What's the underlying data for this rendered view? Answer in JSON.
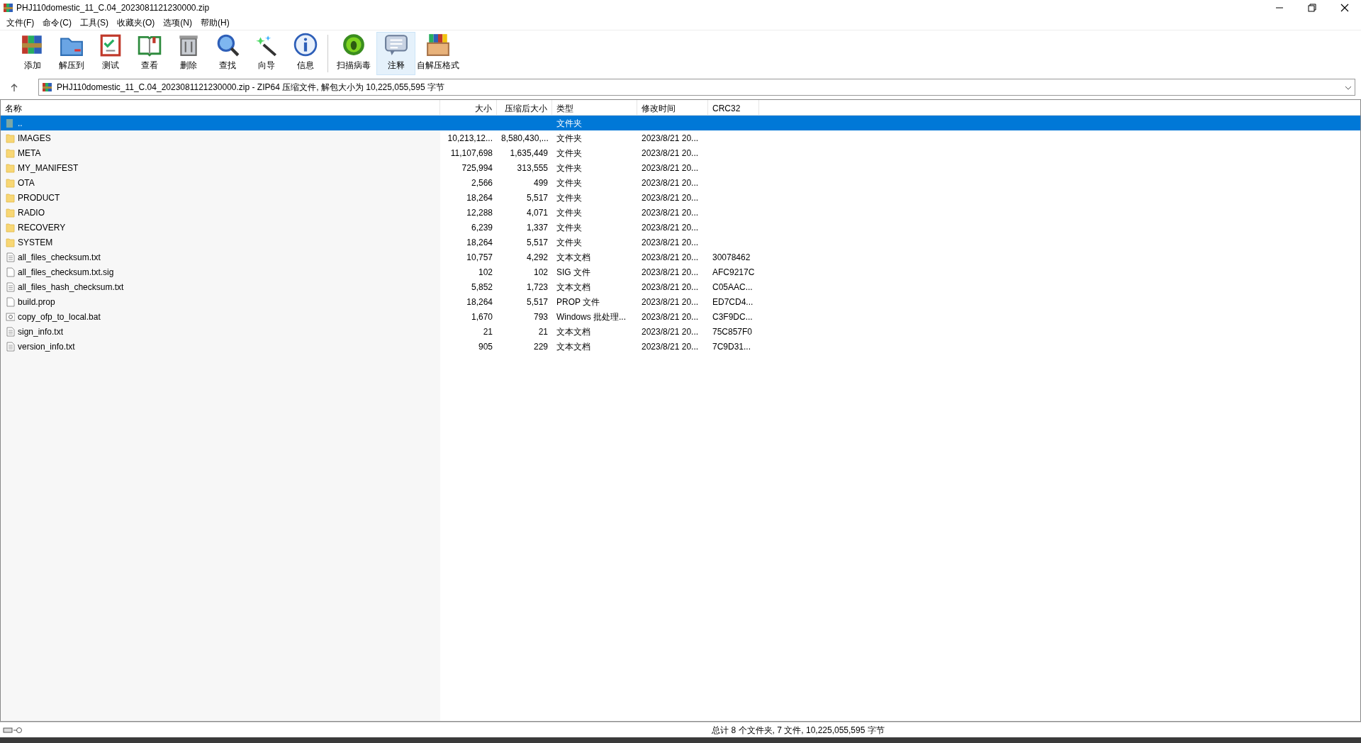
{
  "window": {
    "title": "PHJ110domestic_11_C.04_2023081121230000.zip"
  },
  "menu": [
    "文件(F)",
    "命令(C)",
    "工具(S)",
    "收藏夹(O)",
    "选项(N)",
    "帮助(H)"
  ],
  "toolbar": [
    {
      "kind": "add",
      "label": "添加",
      "highlighted": false
    },
    {
      "kind": "extract",
      "label": "解压到",
      "highlighted": false
    },
    {
      "kind": "test",
      "label": "测试",
      "highlighted": false
    },
    {
      "kind": "view",
      "label": "查看",
      "highlighted": false
    },
    {
      "kind": "delete",
      "label": "删除",
      "highlighted": false
    },
    {
      "kind": "find",
      "label": "查找",
      "highlighted": false
    },
    {
      "kind": "wizard",
      "label": "向导",
      "highlighted": false
    },
    {
      "kind": "info",
      "label": "信息",
      "highlighted": false
    },
    {
      "kind": "scan",
      "label": "扫描病毒",
      "highlighted": false
    },
    {
      "kind": "comment",
      "label": "注释",
      "highlighted": true
    },
    {
      "kind": "sfx",
      "label": "自解压格式",
      "highlighted": false
    }
  ],
  "address": {
    "text": "PHJ110domestic_11_C.04_2023081121230000.zip - ZIP64 压缩文件, 解包大小为 10,225,055,595 字节"
  },
  "table": {
    "columns": [
      "名称",
      "大小",
      "压缩后大小",
      "类型",
      "修改时间",
      "CRC32"
    ],
    "rows": [
      {
        "kind": "parent",
        "name": "..",
        "size": "",
        "packed": "",
        "type": "文件夹",
        "modified": "",
        "crc": "",
        "selected": true
      },
      {
        "kind": "folder",
        "name": "IMAGES",
        "size": "10,213,12...",
        "packed": "8,580,430,...",
        "type": "文件夹",
        "modified": "2023/8/21 20...",
        "crc": "",
        "selected": false
      },
      {
        "kind": "folder",
        "name": "META",
        "size": "11,107,698",
        "packed": "1,635,449",
        "type": "文件夹",
        "modified": "2023/8/21 20...",
        "crc": "",
        "selected": false
      },
      {
        "kind": "folder",
        "name": "MY_MANIFEST",
        "size": "725,994",
        "packed": "313,555",
        "type": "文件夹",
        "modified": "2023/8/21 20...",
        "crc": "",
        "selected": false
      },
      {
        "kind": "folder",
        "name": "OTA",
        "size": "2,566",
        "packed": "499",
        "type": "文件夹",
        "modified": "2023/8/21 20...",
        "crc": "",
        "selected": false
      },
      {
        "kind": "folder",
        "name": "PRODUCT",
        "size": "18,264",
        "packed": "5,517",
        "type": "文件夹",
        "modified": "2023/8/21 20...",
        "crc": "",
        "selected": false
      },
      {
        "kind": "folder",
        "name": "RADIO",
        "size": "12,288",
        "packed": "4,071",
        "type": "文件夹",
        "modified": "2023/8/21 20...",
        "crc": "",
        "selected": false
      },
      {
        "kind": "folder",
        "name": "RECOVERY",
        "size": "6,239",
        "packed": "1,337",
        "type": "文件夹",
        "modified": "2023/8/21 20...",
        "crc": "",
        "selected": false
      },
      {
        "kind": "folder",
        "name": "SYSTEM",
        "size": "18,264",
        "packed": "5,517",
        "type": "文件夹",
        "modified": "2023/8/21 20...",
        "crc": "",
        "selected": false
      },
      {
        "kind": "text",
        "name": "all_files_checksum.txt",
        "size": "10,757",
        "packed": "4,292",
        "type": "文本文档",
        "modified": "2023/8/21 20...",
        "crc": "30078462",
        "selected": false
      },
      {
        "kind": "file",
        "name": "all_files_checksum.txt.sig",
        "size": "102",
        "packed": "102",
        "type": "SIG 文件",
        "modified": "2023/8/21 20...",
        "crc": "AFC9217C",
        "selected": false
      },
      {
        "kind": "text",
        "name": "all_files_hash_checksum.txt",
        "size": "5,852",
        "packed": "1,723",
        "type": "文本文档",
        "modified": "2023/8/21 20...",
        "crc": "C05AAC...",
        "selected": false
      },
      {
        "kind": "file",
        "name": "build.prop",
        "size": "18,264",
        "packed": "5,517",
        "type": "PROP 文件",
        "modified": "2023/8/21 20...",
        "crc": "ED7CD4...",
        "selected": false
      },
      {
        "kind": "batch",
        "name": "copy_ofp_to_local.bat",
        "size": "1,670",
        "packed": "793",
        "type": "Windows 批处理...",
        "modified": "2023/8/21 20...",
        "crc": "C3F9DC...",
        "selected": false
      },
      {
        "kind": "text",
        "name": "sign_info.txt",
        "size": "21",
        "packed": "21",
        "type": "文本文档",
        "modified": "2023/8/21 20...",
        "crc": "75C857F0",
        "selected": false
      },
      {
        "kind": "text",
        "name": "version_info.txt",
        "size": "905",
        "packed": "229",
        "type": "文本文档",
        "modified": "2023/8/21 20...",
        "crc": "7C9D31...",
        "selected": false
      }
    ]
  },
  "status_bar": {
    "text": "总计 8 个文件夹, 7 文件, 10,225,055,595 字节"
  }
}
